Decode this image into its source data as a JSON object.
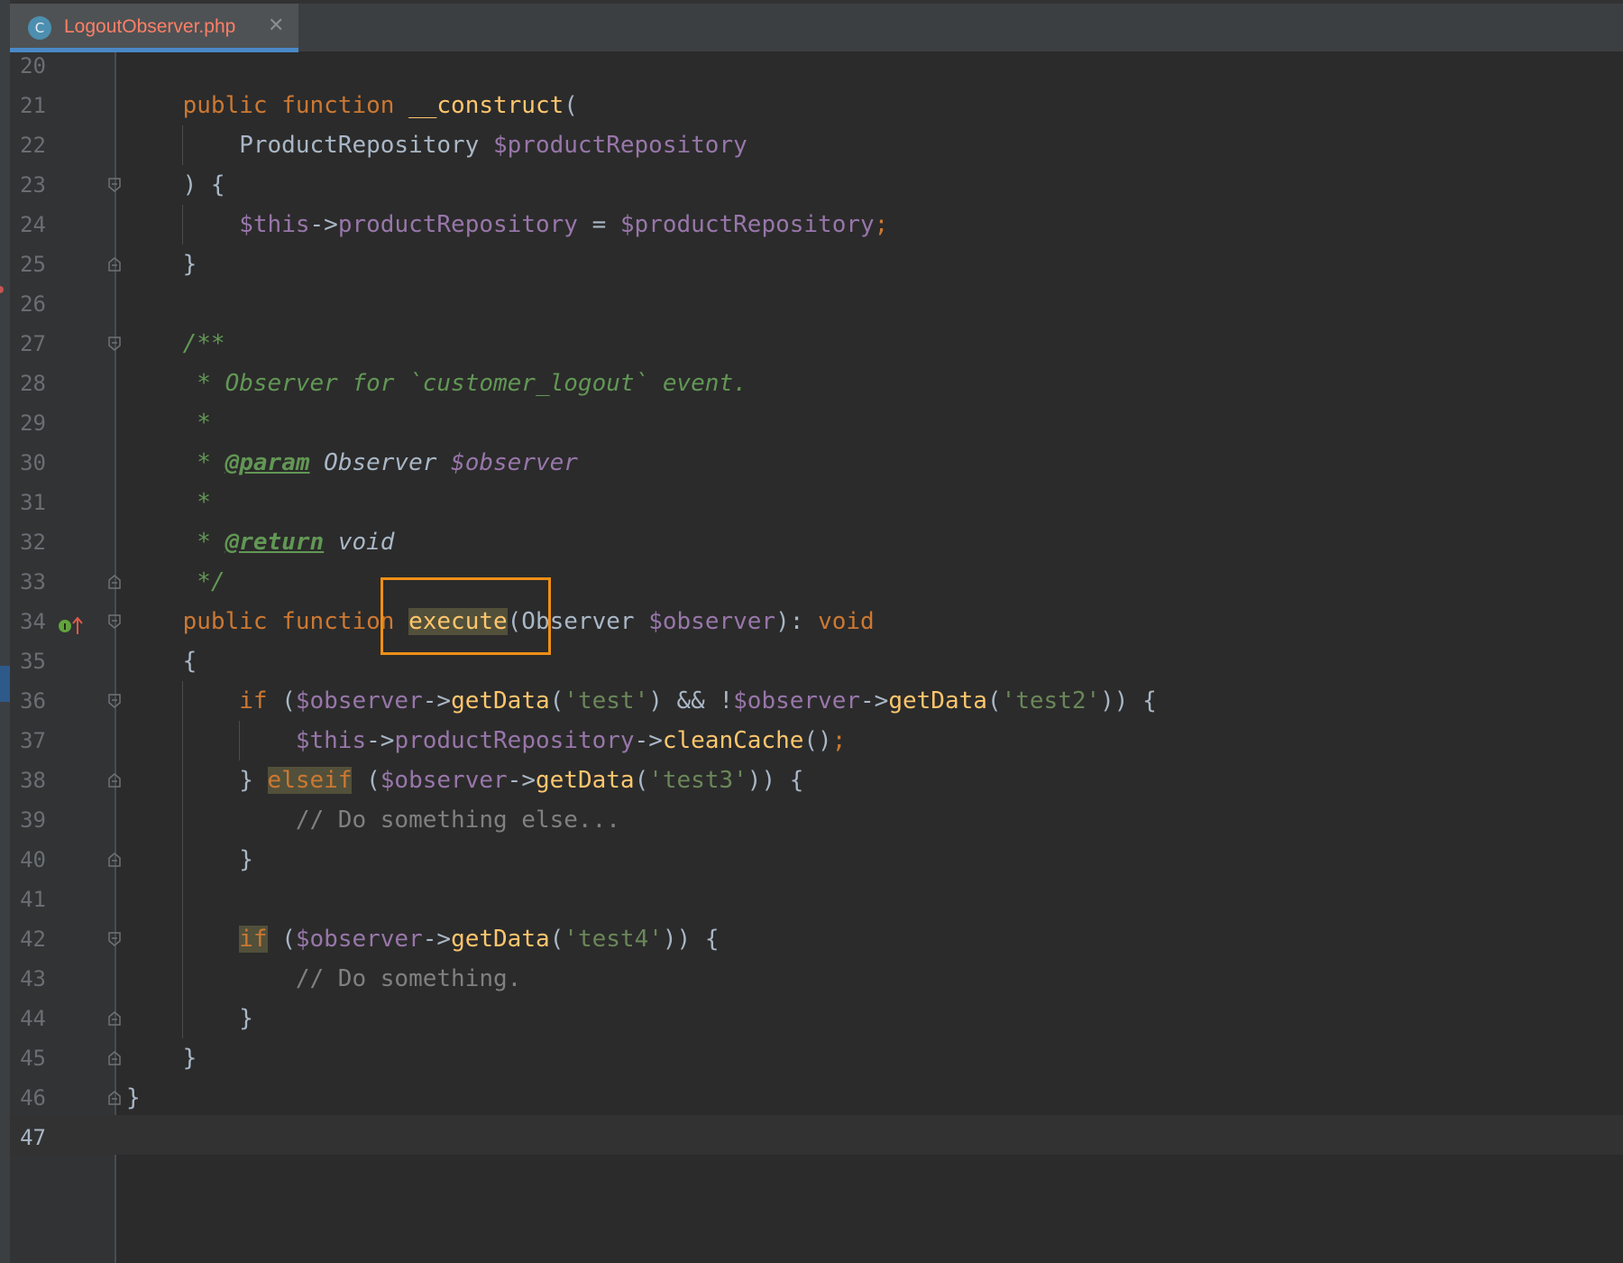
{
  "tab": {
    "icon": "C",
    "title": "LogoutObserver.php"
  },
  "lines": [
    {
      "n": "20",
      "t": ""
    },
    {
      "n": "21",
      "t": "public function __construct("
    },
    {
      "n": "22",
      "t": "ProductRepository $productRepository"
    },
    {
      "n": "23",
      "t": ") {"
    },
    {
      "n": "24",
      "t": "$this->productRepository = $productRepository;"
    },
    {
      "n": "25",
      "t": "}"
    },
    {
      "n": "26",
      "t": ""
    },
    {
      "n": "27",
      "t": "/**"
    },
    {
      "n": "28",
      "t": "* Observer for `customer_logout` event."
    },
    {
      "n": "29",
      "t": "*"
    },
    {
      "n": "30",
      "t": "* @param Observer $observer"
    },
    {
      "n": "31",
      "t": "*"
    },
    {
      "n": "32",
      "t": "* @return void"
    },
    {
      "n": "33",
      "t": "*/"
    },
    {
      "n": "34",
      "t": "public function execute(Observer $observer): void"
    },
    {
      "n": "35",
      "t": "{"
    },
    {
      "n": "36",
      "t": "if ($observer->getData('test') && !$observer->getData('test2')) {"
    },
    {
      "n": "37",
      "t": "$this->productRepository->cleanCache();"
    },
    {
      "n": "38",
      "t": "} elseif ($observer->getData('test3')) {"
    },
    {
      "n": "39",
      "t": "// Do something else..."
    },
    {
      "n": "40",
      "t": "}"
    },
    {
      "n": "41",
      "t": ""
    },
    {
      "n": "42",
      "t": "if ($observer->getData('test4')) {"
    },
    {
      "n": "43",
      "t": "// Do something."
    },
    {
      "n": "44",
      "t": "}"
    },
    {
      "n": "45",
      "t": "}"
    },
    {
      "n": "46",
      "t": "}"
    },
    {
      "n": "47",
      "t": ""
    }
  ],
  "colors": {
    "keyword": "#cc7832",
    "function": "#ffc66d",
    "variable": "#9876aa",
    "string": "#6a8759",
    "comment": "#808080",
    "doc": "#629755",
    "highlight_box": "#ef8f16"
  },
  "icons": {
    "gutter_marker": "implements-method-icon",
    "fold": "fold-marker-icon"
  }
}
